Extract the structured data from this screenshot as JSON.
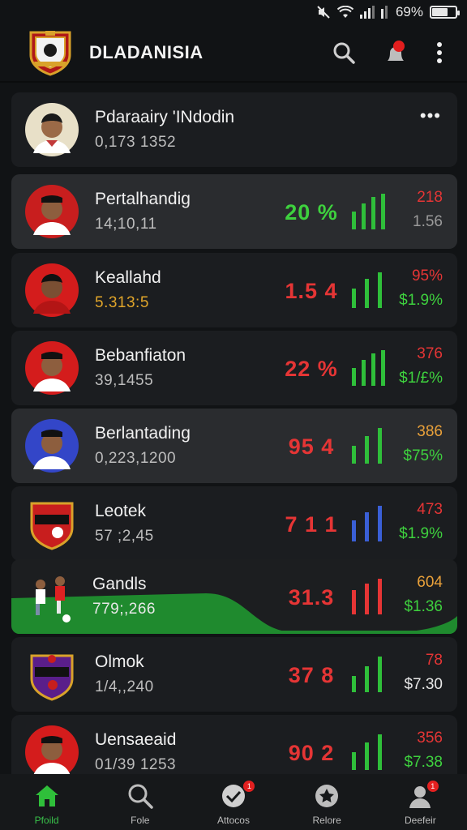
{
  "status_bar": {
    "battery_text": "69%",
    "battery_level": 0.69
  },
  "header": {
    "title": "DLADANISIA"
  },
  "rows": [
    {
      "name": "Pdaraairy 'INdodin",
      "number": "0,173 1352",
      "percent": "",
      "top": "",
      "bottom": "",
      "more": "•••"
    },
    {
      "name": "Pertalhandig",
      "number": "14;10,11",
      "percent": "20 %",
      "top": "218",
      "bottom": "1.56"
    },
    {
      "name": "Keallahd",
      "number": "5.313:5",
      "percent": "1.5 4",
      "top": "95%",
      "bottom": "$1.9%"
    },
    {
      "name": "Bebanfiaton",
      "number": "39,1455",
      "percent": "22 %",
      "top": "376",
      "bottom": "$1/£%"
    },
    {
      "name": "Berlantading",
      "number": "0,223,1200",
      "percent": "95 4",
      "top": "386",
      "bottom": "$75%"
    },
    {
      "name": "Leotek",
      "number": "57 ;2,45",
      "percent": "7 1 1",
      "top": "473",
      "bottom": "$1.9%"
    },
    {
      "name": "Gandls",
      "number": "779;,266",
      "percent": "31.3",
      "top": "604",
      "bottom": "$1.36"
    },
    {
      "name": "Olmok",
      "number": "1/4,,240",
      "percent": "37 8",
      "top": "78",
      "bottom": "$7.30"
    },
    {
      "name": "Uensaeaid",
      "number": "01/39 1253",
      "percent": "90 2",
      "top": "356",
      "bottom": "$7.38"
    }
  ],
  "bottom_nav": [
    {
      "label": "Pfoild",
      "icon": "home-icon",
      "badge": ""
    },
    {
      "label": "Fole",
      "icon": "search-icon",
      "badge": ""
    },
    {
      "label": "Attocos",
      "icon": "chat-icon",
      "badge": "1"
    },
    {
      "label": "Relore",
      "icon": "star-icon",
      "badge": ""
    },
    {
      "label": "Deefeir",
      "icon": "profile-icon",
      "badge": "1"
    }
  ]
}
